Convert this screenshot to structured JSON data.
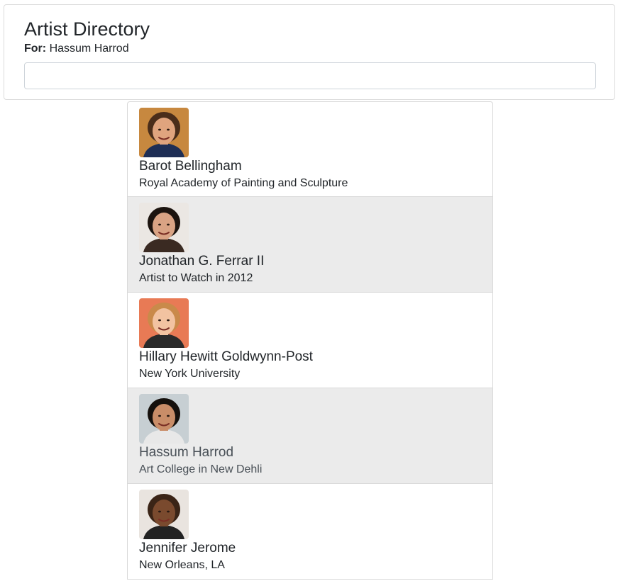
{
  "header": {
    "title": "Artist Directory",
    "for_label": "For:",
    "for_value": "Hassum Harrod"
  },
  "search": {
    "value": "",
    "placeholder": ""
  },
  "artists": [
    {
      "name": "Barot Bellingham",
      "reknown": "Royal Academy of Painting and Sculpture",
      "skin": "#e0a47e",
      "hair": "#4a2d1a",
      "bg": "#c7883f",
      "shirt": "#1e2e55"
    },
    {
      "name": "Jonathan G. Ferrar II",
      "reknown": "Artist to Watch in 2012",
      "skin": "#d9a384",
      "hair": "#1c140f",
      "bg": "#ebe7e3",
      "shirt": "#3a2a22"
    },
    {
      "name": "Hillary Hewitt Goldwynn-Post",
      "reknown": "New York University",
      "skin": "#f2c3a1",
      "hair": "#c98a4a",
      "bg": "#e87a55",
      "shirt": "#2a2a2a"
    },
    {
      "name": "Hassum Harrod",
      "reknown": "Art College in New Dehli",
      "skin": "#c98d68",
      "hair": "#15100c",
      "bg": "#c7cfd3",
      "shirt": "#e8e8e8"
    },
    {
      "name": "Jennifer Jerome",
      "reknown": "New Orleans, LA",
      "skin": "#7a4a2e",
      "hair": "#3a2416",
      "bg": "#e9e4df",
      "shirt": "#222222"
    }
  ],
  "selected_index": 3
}
